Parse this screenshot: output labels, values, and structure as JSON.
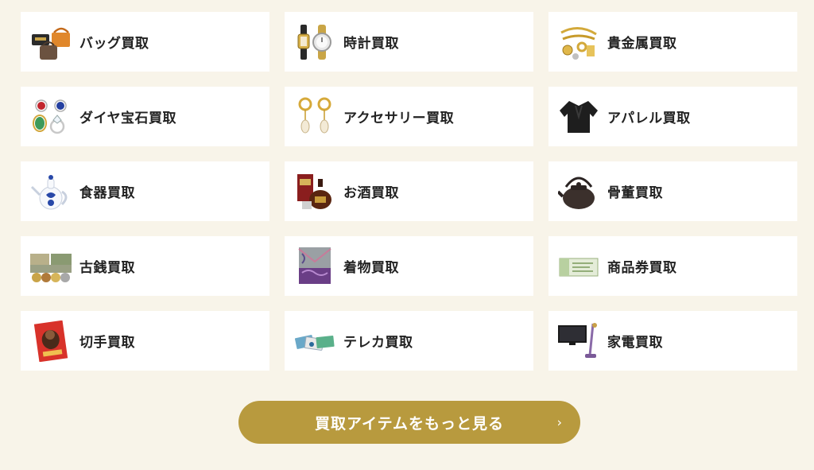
{
  "categories": [
    {
      "label": "バッグ買取",
      "icon": "handbag-icon"
    },
    {
      "label": "時計買取",
      "icon": "wristwatch-icon"
    },
    {
      "label": "貴金属買取",
      "icon": "gold-jewelry-icon"
    },
    {
      "label": "ダイヤ宝石買取",
      "icon": "gem-ring-icon"
    },
    {
      "label": "アクセサリー買取",
      "icon": "earrings-icon"
    },
    {
      "label": "アパレル買取",
      "icon": "jacket-icon"
    },
    {
      "label": "食器買取",
      "icon": "teapot-icon"
    },
    {
      "label": "お酒買取",
      "icon": "liquor-bottle-icon"
    },
    {
      "label": "骨董買取",
      "icon": "iron-kettle-icon"
    },
    {
      "label": "古銭買取",
      "icon": "old-coins-icon"
    },
    {
      "label": "着物買取",
      "icon": "kimono-icon"
    },
    {
      "label": "商品券買取",
      "icon": "gift-voucher-icon"
    },
    {
      "label": "切手買取",
      "icon": "stamp-icon"
    },
    {
      "label": "テレカ買取",
      "icon": "phone-card-icon"
    },
    {
      "label": "家電買取",
      "icon": "tv-appliance-icon"
    }
  ],
  "more_button": {
    "label": "買取アイテムをもっと見る",
    "chevron": "›"
  },
  "colors": {
    "background": "#f8f4e9",
    "card": "#ffffff",
    "button": "#b89a3e"
  }
}
